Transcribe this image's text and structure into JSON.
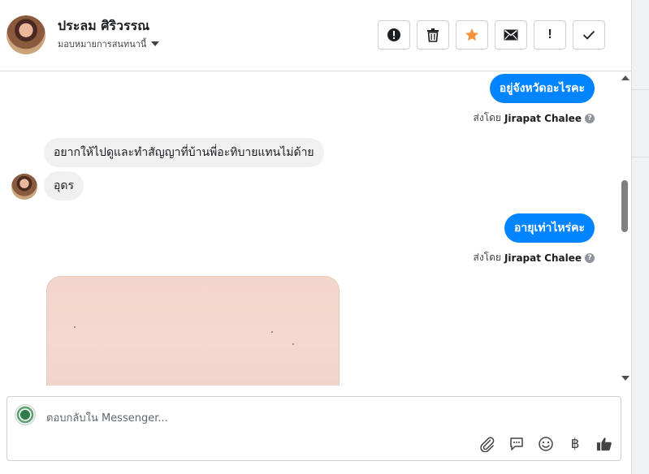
{
  "header": {
    "contact_name": "ประลม ศิริวรรณ",
    "assign_label": "มอบหมายการสนทนานี้",
    "toolbar": [
      {
        "name": "report-button",
        "icon": "alert-circle-icon"
      },
      {
        "name": "delete-button",
        "icon": "trash-icon"
      },
      {
        "name": "star-button",
        "icon": "star-icon",
        "color": "#f7923b"
      },
      {
        "name": "mark-unread-button",
        "icon": "envelope-icon"
      },
      {
        "name": "priority-button",
        "icon": "exclamation-icon",
        "label": "!"
      },
      {
        "name": "done-button",
        "icon": "check-icon"
      }
    ]
  },
  "thread": {
    "messages": [
      {
        "direction": "out",
        "text": "อยู่จังหวัดอะไรคะ",
        "sent_by_prefix": "ส่งโดย",
        "sent_by_name": "Jirapat Chalee"
      },
      {
        "direction": "in",
        "text": "อยากให้ไปดูและทำสัญญาที่บ้านพี่อะทิบายแทนไม่ด้าย"
      },
      {
        "direction": "in",
        "text": "อุดร"
      },
      {
        "direction": "out",
        "text": "อายุเท่าไหร่คะ",
        "sent_by_prefix": "ส่งโดย",
        "sent_by_name": "Jirapat Chalee"
      }
    ],
    "help_glyph": "?"
  },
  "composer": {
    "placeholder": "ตอบกลับใน Messenger...",
    "icons": [
      "paperclip-icon",
      "saved-reply-icon",
      "emoji-icon",
      "payment-icon",
      "thumbs-up-icon"
    ],
    "payment_glyph": "฿"
  },
  "colors": {
    "accent": "#0084ff",
    "star": "#f7923b",
    "incoming_bubble": "#f0f0f0"
  }
}
